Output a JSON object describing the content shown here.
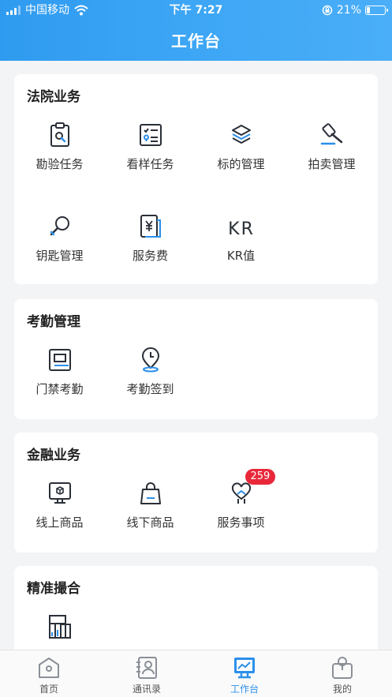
{
  "status_bar": {
    "carrier": "中国移动",
    "time": "下午 7:27",
    "battery": "21%",
    "battery_level": 0.21
  },
  "header": {
    "title": "工作台"
  },
  "sections": [
    {
      "title": "法院业务",
      "items": [
        {
          "label": "勘验任务",
          "icon": "clipboard-search-icon"
        },
        {
          "label": "看样任务",
          "icon": "checklist-location-icon"
        },
        {
          "label": "标的管理",
          "icon": "layers-icon"
        },
        {
          "label": "拍卖管理",
          "icon": "gavel-icon"
        },
        {
          "label": "钥匙管理",
          "icon": "key-icon"
        },
        {
          "label": "服务费",
          "icon": "yen-receipt-icon"
        },
        {
          "label": "KR值",
          "icon": "kr-icon",
          "glyph": "KR"
        }
      ]
    },
    {
      "title": "考勤管理",
      "items": [
        {
          "label": "门禁考勤",
          "icon": "access-card-icon"
        },
        {
          "label": "考勤签到",
          "icon": "clock-pin-icon"
        }
      ]
    },
    {
      "title": "金融业务",
      "items": [
        {
          "label": "线上商品",
          "icon": "monitor-box-icon"
        },
        {
          "label": "线下商品",
          "icon": "shopping-bag-icon"
        },
        {
          "label": "服务事项",
          "icon": "heart-hand-icon",
          "badge": "259"
        }
      ]
    },
    {
      "title": "精准撮合",
      "items": [
        {
          "label": "",
          "icon": "building-chart-icon"
        }
      ]
    }
  ],
  "tabbar": {
    "items": [
      {
        "label": "首页",
        "icon": "home-icon",
        "active": false
      },
      {
        "label": "通讯录",
        "icon": "contacts-icon",
        "active": false
      },
      {
        "label": "工作台",
        "icon": "workbench-icon",
        "active": true
      },
      {
        "label": "我的",
        "icon": "profile-icon",
        "active": false
      }
    ]
  },
  "colors": {
    "primary": "#2b8fea",
    "icon_dark": "#2a2f38",
    "badge": "#e8283a"
  }
}
